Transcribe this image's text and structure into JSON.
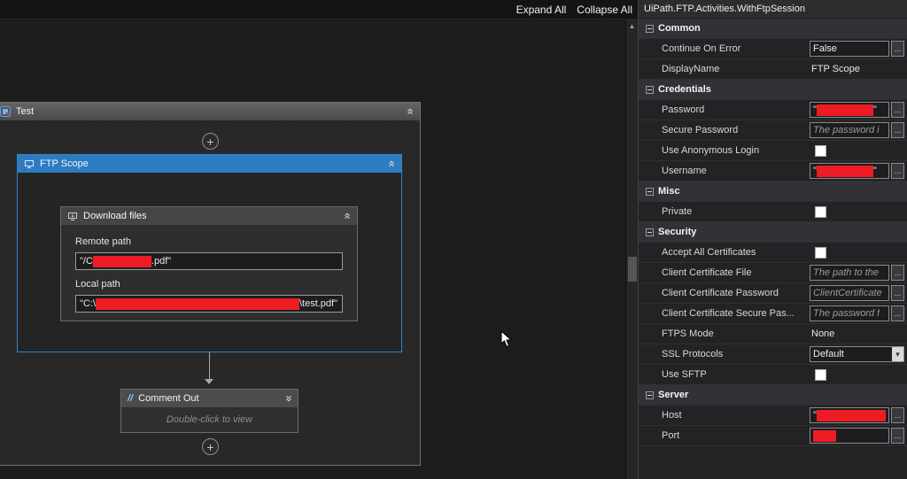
{
  "toolbar": {
    "expand_all": "Expand All",
    "collapse_all": "Collapse All"
  },
  "colors": {
    "redaction": "#ed1c24",
    "accent_blue": "#2d7cc1"
  },
  "canvas": {
    "test_title": "Test",
    "ftp_scope_title": "FTP Scope",
    "download": {
      "title": "Download files",
      "remote_label": "Remote path",
      "remote_prefix": "\"/C",
      "remote_suffix": ".pdf\"",
      "remote_red_width": 66,
      "local_label": "Local path",
      "local_prefix": "\"C:\\",
      "local_suffix": "\\test.pdf\"",
      "local_red_width": 230
    },
    "comment_out": {
      "icon_label": "//",
      "title": "Comment Out",
      "body": "Double-click to view"
    }
  },
  "properties": {
    "title": "UiPath.FTP.Activities.WithFtpSession",
    "ellipsis_label": "...",
    "sections": [
      {
        "name": "Common",
        "rows": [
          {
            "label": "Continue On Error",
            "control": "textbox",
            "value": "False",
            "ellipsis": true
          },
          {
            "label": "DisplayName",
            "control": "text",
            "value": "FTP Scope"
          }
        ]
      },
      {
        "name": "Credentials",
        "rows": [
          {
            "label": "Password",
            "control": "redacted",
            "prefix": "\"",
            "suffix": "\"",
            "red_width": 64,
            "ellipsis": true
          },
          {
            "label": "Secure Password",
            "control": "placeholder",
            "value": "The password i",
            "ellipsis": true
          },
          {
            "label": "Use Anonymous Login",
            "control": "checkbox",
            "checked": false
          },
          {
            "label": "Username",
            "control": "redacted",
            "prefix": "\"",
            "suffix": "\"",
            "red_width": 64,
            "ellipsis": true
          }
        ]
      },
      {
        "name": "Misc",
        "rows": [
          {
            "label": "Private",
            "control": "checkbox",
            "checked": false
          }
        ]
      },
      {
        "name": "Security",
        "rows": [
          {
            "label": "Accept All Certificates",
            "control": "checkbox",
            "checked": false
          },
          {
            "label": "Client Certificate File",
            "control": "placeholder",
            "value": "The path to the",
            "ellipsis": true
          },
          {
            "label": "Client Certificate Password",
            "control": "placeholder",
            "value": "ClientCertificate",
            "ellipsis": true
          },
          {
            "label": "Client Certificate Secure Pas...",
            "control": "placeholder",
            "value": "The password f",
            "ellipsis": true
          },
          {
            "label": "FTPS Mode",
            "control": "text",
            "value": "None"
          },
          {
            "label": "SSL Protocols",
            "control": "dropdown",
            "value": "Default"
          },
          {
            "label": "Use SFTP",
            "control": "checkbox",
            "checked": false
          }
        ]
      },
      {
        "name": "Server",
        "rows": [
          {
            "label": "Host",
            "control": "redacted",
            "prefix": "\"",
            "suffix": "",
            "red_width": 78,
            "ellipsis": true
          },
          {
            "label": "Port",
            "control": "redacted",
            "prefix": "",
            "suffix": "",
            "red_width": 26,
            "ellipsis": true
          }
        ]
      }
    ]
  }
}
